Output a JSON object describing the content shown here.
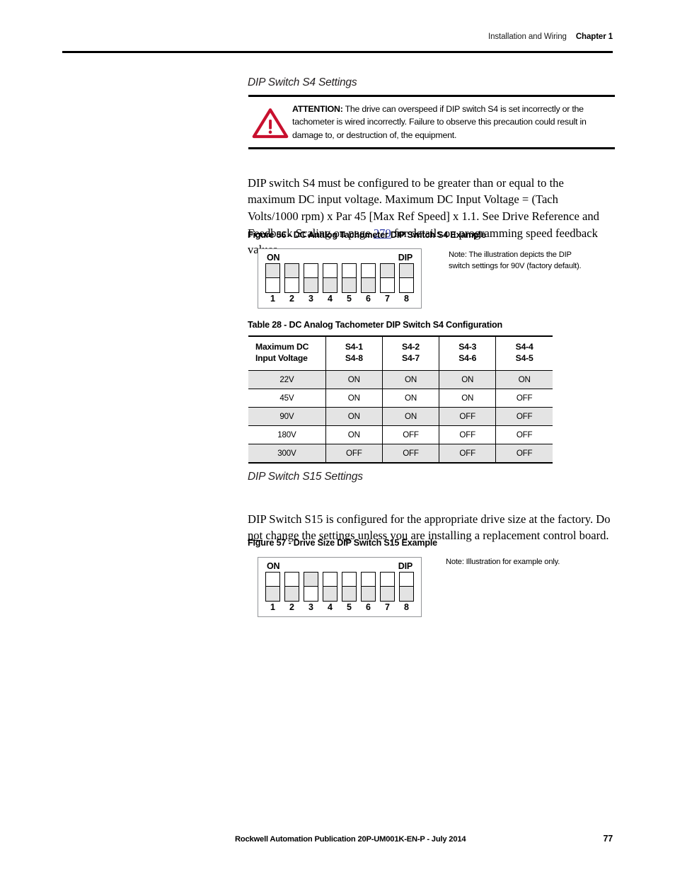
{
  "header": {
    "section": "Installation and Wiring",
    "chapter": "Chapter 1"
  },
  "sections": {
    "s4_heading": "DIP Switch S4 Settings",
    "s15_heading": "DIP Switch S15 Settings"
  },
  "attention": {
    "label": "ATTENTION:",
    "text": " The drive can overspeed if DIP switch S4 is set incorrectly or the tachometer is wired incorrectly. Failure to observe this precaution could result in damage to, or destruction of, the equipment.",
    "icon": "warning-triangle-icon",
    "color": "#C8102E"
  },
  "paragraphs": {
    "s4_part1": "DIP switch S4 must be configured to be greater than or equal to the maximum DC input voltage. Maximum DC Input Voltage = (Tach Volts/1000 rpm) x Par 45 [Max Ref Speed] x 1.1. See Drive Reference and Feedback Scaling on page ",
    "s4_link": "279",
    "s4_part2": " for details on programming speed feedback values.",
    "s15_part1": "DIP Switch S15 is configured for the appropriate drive size at the factory. Do ",
    "s15_emphasis": "not",
    "s15_part2": " change the settings unless you are installing a replacement control board."
  },
  "figure56": {
    "caption": "Figure 56 - DC Analog Tachometer DIP Switch S4 Example",
    "on_label": "ON",
    "dip_label": "DIP",
    "note": "Note: The illustration depicts the DIP switch settings for 90V (factory default).",
    "switches": [
      {
        "number": "1",
        "state": "ON"
      },
      {
        "number": "2",
        "state": "ON"
      },
      {
        "number": "3",
        "state": "OFF"
      },
      {
        "number": "4",
        "state": "OFF"
      },
      {
        "number": "5",
        "state": "OFF"
      },
      {
        "number": "6",
        "state": "OFF"
      },
      {
        "number": "7",
        "state": "ON"
      },
      {
        "number": "8",
        "state": "ON"
      }
    ]
  },
  "figure57": {
    "caption": "Figure 57 - Drive Size DIP Switch S15 Example",
    "on_label": "ON",
    "dip_label": "DIP",
    "note": "Note: Illustration for example only.",
    "switches": [
      {
        "number": "1",
        "state": "OFF"
      },
      {
        "number": "2",
        "state": "OFF"
      },
      {
        "number": "3",
        "state": "ON"
      },
      {
        "number": "4",
        "state": "OFF"
      },
      {
        "number": "5",
        "state": "OFF"
      },
      {
        "number": "6",
        "state": "OFF"
      },
      {
        "number": "7",
        "state": "OFF"
      },
      {
        "number": "8",
        "state": "OFF"
      }
    ]
  },
  "table28": {
    "caption": "Table 28 - DC Analog Tachometer DIP Switch S4 Configuration",
    "headers": [
      {
        "line1": "Maximum DC",
        "line2": "Input Voltage"
      },
      {
        "line1": "S4-1",
        "line2": "S4-8"
      },
      {
        "line1": "S4-2",
        "line2": "S4-7"
      },
      {
        "line1": "S4-3",
        "line2": "S4-6"
      },
      {
        "line1": "S4-4",
        "line2": "S4-5"
      }
    ],
    "rows": [
      {
        "voltage": "22V",
        "s1": "ON",
        "s2": "ON",
        "s3": "ON",
        "s4": "ON",
        "shaded": true
      },
      {
        "voltage": "45V",
        "s1": "ON",
        "s2": "ON",
        "s3": "ON",
        "s4": "OFF",
        "shaded": false
      },
      {
        "voltage": "90V",
        "s1": "ON",
        "s2": "ON",
        "s3": "OFF",
        "s4": "OFF",
        "shaded": true
      },
      {
        "voltage": "180V",
        "s1": "ON",
        "s2": "OFF",
        "s3": "OFF",
        "s4": "OFF",
        "shaded": false
      },
      {
        "voltage": "300V",
        "s1": "OFF",
        "s2": "OFF",
        "s3": "OFF",
        "s4": "OFF",
        "shaded": true
      }
    ]
  },
  "footer": {
    "publication": "Rockwell Automation Publication 20P-UM001K-EN-P - July 2014",
    "page": "77"
  }
}
